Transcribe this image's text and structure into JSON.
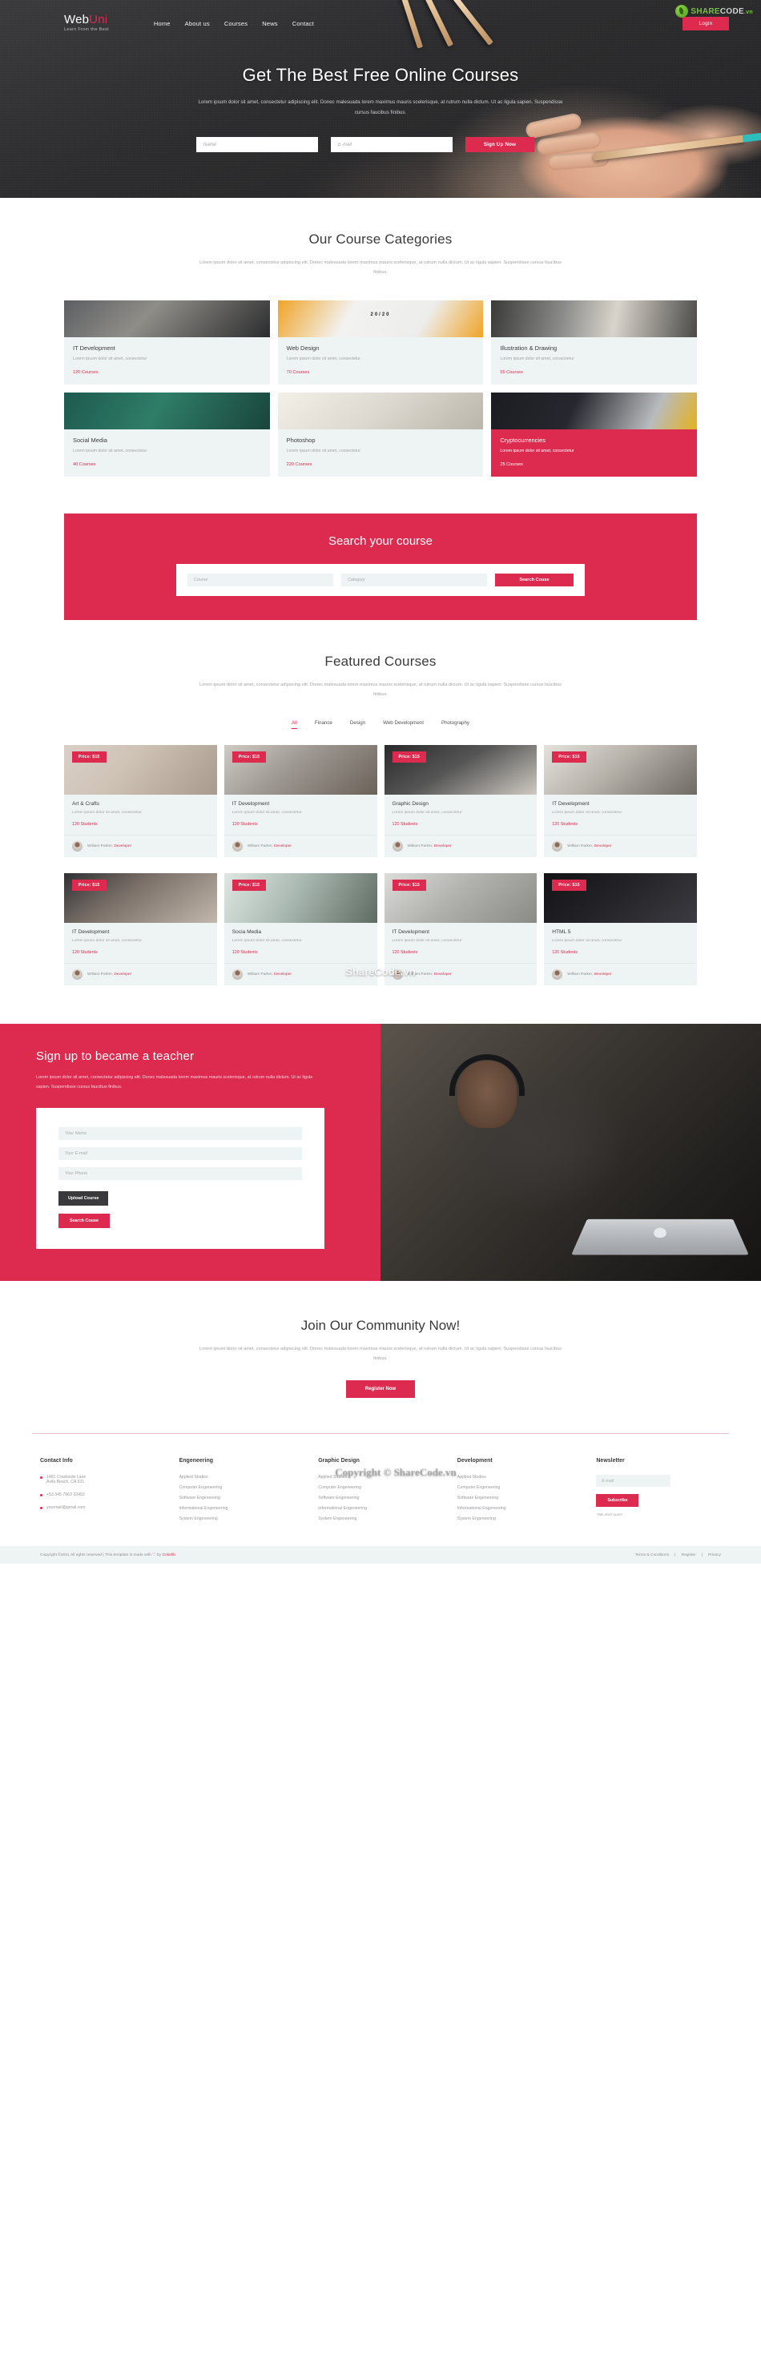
{
  "header": {
    "brand_name_primary": "Web",
    "brand_name_accent": "Uni",
    "brand_tagline": "Learn From the Best",
    "nav": [
      {
        "label": "Home"
      },
      {
        "label": "About us"
      },
      {
        "label": "Courses"
      },
      {
        "label": "News"
      },
      {
        "label": "Contact"
      }
    ],
    "login_label": "Login"
  },
  "watermark": {
    "logo_text_a": "SHARE",
    "logo_text_b": "CODE",
    "logo_text_c": ".vn",
    "center_small": "ShareCode.vn",
    "center_big": "Copyright © ShareCode.vn"
  },
  "hero": {
    "title": "Get The Best Free Online Courses",
    "subtitle": "Lorem ipsum dolor sit amet, consectetur adipiscing elit. Donec malesuada lorem maximus mauris scelerisque, at rutrum nulla dictum. Ut ac ligula sapien. Suspendisse cursus faucibus finibus.",
    "name_placeholder": "Name",
    "email_placeholder": "E-mail",
    "signup_label": "Sign Up Now"
  },
  "categories_section": {
    "title": "Our Course Categories",
    "subtitle": "Lorem ipsum dolor sit amet, consectetur adipiscing elit. Donec malesuada lorem maximus mauris scelerisque, at rutrum nulla dictum. Ut ac ligula sapien. Suspendisse cursus faucibus finibus.",
    "items": [
      {
        "name": "IT Development",
        "desc": "Lorem ipsum dolor sit amet, consectetur",
        "count": "120 Courses"
      },
      {
        "name": "Web Design",
        "desc": "Lorem ipsum dolor sit amet, consectetur",
        "count": "70 Courses"
      },
      {
        "name": "Illustration & Drawing",
        "desc": "Lorem ipsum dolor sit amet, consectetur",
        "count": "55 Courses"
      },
      {
        "name": "Social Media",
        "desc": "Lorem ipsum dolor sit amet, consectetur",
        "count": "40 Courses"
      },
      {
        "name": "Photoshop",
        "desc": "Lorem ipsum dolor sit amet, consectetur",
        "count": "220 Courses"
      },
      {
        "name": "Cryptocurrencies",
        "desc": "Lorem ipsum dolor sit amet, consectetur",
        "count": "25 Courses"
      }
    ]
  },
  "search_band": {
    "title": "Search your course",
    "course_placeholder": "Course",
    "category_placeholder": "Category",
    "button_label": "Search Couse"
  },
  "featured": {
    "title": "Featured Courses",
    "subtitle": "Lorem ipsum dolor sit amet, consectetur adipiscing elit. Donec malesuada lorem maximus mauris scelerisque, at rutrum nulla dictum. Ut ac ligula sapien. Suspendisse cursus faucibus finibus.",
    "tabs": [
      {
        "label": "All",
        "active": true
      },
      {
        "label": "Finance",
        "active": false
      },
      {
        "label": "Design",
        "active": false
      },
      {
        "label": "Web Development",
        "active": false
      },
      {
        "label": "Photography",
        "active": false
      }
    ],
    "courses": [
      {
        "price": "Price: $15",
        "name": "Art & Crafts",
        "desc": "Lorem ipsum dolor sit amet, consectetur",
        "students": "120 Students",
        "author": "William Parker,",
        "role": "Developer"
      },
      {
        "price": "Price: $15",
        "name": "IT Development",
        "desc": "Lorem ipsum dolor sit amet, consectetur",
        "students": "120 Students",
        "author": "William Parker,",
        "role": "Developer"
      },
      {
        "price": "Price: $15",
        "name": "Graphic Design",
        "desc": "Lorem ipsum dolor sit amet, consectetur",
        "students": "120 Students",
        "author": "William Parker,",
        "role": "Developer"
      },
      {
        "price": "Price: $15",
        "name": "IT Development",
        "desc": "Lorem ipsum dolor sit amet, consectetur",
        "students": "120 Students",
        "author": "William Parker,",
        "role": "Developer"
      },
      {
        "price": "Price: $15",
        "name": "IT Development",
        "desc": "Lorem ipsum dolor sit amet, consectetur",
        "students": "120 Students",
        "author": "William Parker,",
        "role": "Developer"
      },
      {
        "price": "Price: $15",
        "name": "Socia Media",
        "desc": "Lorem ipsum dolor sit amet, consectetur",
        "students": "120 Students",
        "author": "William Parker,",
        "role": "Developer"
      },
      {
        "price": "Price: $15",
        "name": "IT Development",
        "desc": "Lorem ipsum dolor sit amet, consectetur",
        "students": "120 Students",
        "author": "William Parker,",
        "role": "Developer"
      },
      {
        "price": "Price: $15",
        "name": "HTML 5",
        "desc": "Lorem ipsum dolor sit amet, consectetur",
        "students": "120 Students",
        "author": "William Parker,",
        "role": "Developer"
      }
    ]
  },
  "teacher": {
    "title": "Sign up to became a teacher",
    "text": "Lorem ipsum dolor sit amet, consectetur adipiscing elit. Donec malesuada lorem maximus mauris scelerisque, at rutrum nulla dictum. Ut ac ligula sapien. Suspendisse cursus faucibus finibus.",
    "name_placeholder": "Your Name",
    "email_placeholder": "Your E-mail",
    "phone_placeholder": "Your Phone",
    "upload_label": "Upload Course",
    "search_label": "Search Couse"
  },
  "community": {
    "title": "Join Our Community Now!",
    "text": "Lorem ipsum dolor sit amet, consectetur adipiscing elit. Donec malesuada lorem maximus mauris scelerisque, at rutrum nulla dictum. Ut ac ligula sapien. Suspendisse cursus faucibus finibus.",
    "button_label": "Register Now"
  },
  "footer": {
    "contact": {
      "title": "Contact Info",
      "address_line1": "1481 Creekside Lane",
      "address_line2": "Avila Beach, CA 931",
      "phone": "+53 345 7963 32453",
      "email": "yourmail@gmail.com"
    },
    "columns": [
      {
        "title": "Engeneering",
        "links": [
          "Applied Studies",
          "Computer Engeneering",
          "Software Engeneering",
          "Informational Engeneering",
          "System Engeneering"
        ]
      },
      {
        "title": "Graphic Design",
        "links": [
          "Applied Studies",
          "Computer Engeneering",
          "Software Engeneering",
          "Informational Engeneering",
          "System Engeneering"
        ]
      },
      {
        "title": "Development",
        "links": [
          "Applied Studies",
          "Computer Engeneering",
          "Software Engeneering",
          "Informational Engeneering",
          "System Engeneering"
        ]
      }
    ],
    "newsletter": {
      "title": "Newsletter",
      "email_placeholder": "E-mail",
      "subscribe_label": "Subscribe",
      "note": "*We dont spam"
    },
    "bottom": {
      "copyright_prefix": "Copyright ©2021 All rights reserved | This template is made with ",
      "heart": "♡",
      "copyright_mid": " by ",
      "copyright_author": "Colorlib",
      "links": [
        "Terms & Conditions",
        "|",
        "Register",
        "|",
        "Privacy"
      ]
    }
  }
}
